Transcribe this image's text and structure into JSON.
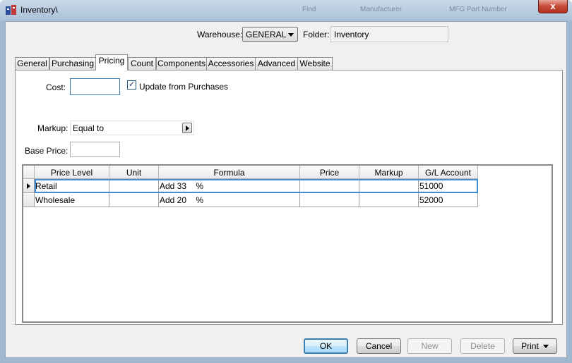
{
  "window": {
    "title": "Inventory\\",
    "close_glyph": "x",
    "background_hints": [
      "Find",
      "Manufacturer",
      "MFG Part Number"
    ]
  },
  "header": {
    "warehouse_label": "Warehouse:",
    "warehouse_value": "GENERAL",
    "folder_label": "Folder:",
    "folder_value": "Inventory"
  },
  "tabs": [
    {
      "label": "General"
    },
    {
      "label": "Purchasing"
    },
    {
      "label": "Pricing",
      "active": true
    },
    {
      "label": "Count"
    },
    {
      "label": "Components"
    },
    {
      "label": "Accessories"
    },
    {
      "label": "Advanced"
    },
    {
      "label": "Website"
    }
  ],
  "pricing": {
    "cost_label": "Cost:",
    "cost_value": "",
    "update_label": "Update from Purchases",
    "update_checked": true,
    "check_glyph": "✓",
    "markup_label": "Markup:",
    "markup_value": "Equal to",
    "base_price_label": "Base Price:",
    "base_price_value": ""
  },
  "grid": {
    "columns": [
      "Price Level",
      "Unit",
      "Formula",
      "Price",
      "Markup",
      "G/L Account"
    ],
    "rows": [
      {
        "price_level": "Retail",
        "unit": "",
        "formula": "Add 33",
        "formula_unit": "%",
        "price": "",
        "markup": "",
        "gl_account": "51000",
        "current": true
      },
      {
        "price_level": "Wholesale",
        "unit": "",
        "formula": "Add 20",
        "formula_unit": "%",
        "price": "",
        "markup": "",
        "gl_account": "52000",
        "current": false
      }
    ]
  },
  "buttons": {
    "ok": "OK",
    "cancel": "Cancel",
    "new": "New",
    "delete": "Delete",
    "print": "Print"
  },
  "colors": {
    "titlebar": "#b6cade",
    "close_button": "#c74a38",
    "focus_border": "#3f8fd4",
    "client_background": "#f0f0f0"
  }
}
